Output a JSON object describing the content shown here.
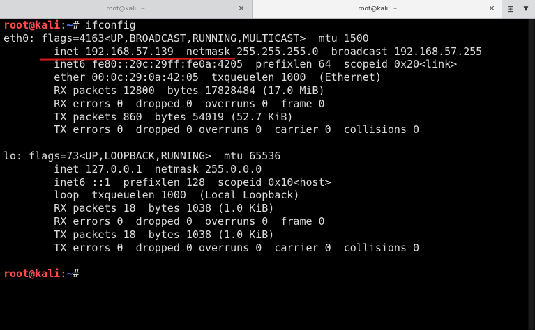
{
  "tabs": [
    {
      "title": "root@kali: ~",
      "active": false
    },
    {
      "title": "root@kali: ~",
      "active": true
    }
  ],
  "tab_close_glyph": "×",
  "new_tab_glyph": "⊞",
  "tab_menu_glyph": "▼",
  "prompt": {
    "user": "root@kali",
    "sep": ":",
    "path": "~",
    "sign": "#"
  },
  "command": " ifconfig",
  "output": [
    "eth0: flags=4163<UP,BROADCAST,RUNNING,MULTICAST>  mtu 1500",
    "        inet 192.168.57.139  netmask 255.255.255.0  broadcast 192.168.57.255",
    "        inet6 fe80::20c:29ff:fe0a:4205  prefixlen 64  scopeid 0x20<link>",
    "        ether 00:0c:29:0a:42:05  txqueuelen 1000  (Ethernet)",
    "        RX packets 12800  bytes 17828484 (17.0 MiB)",
    "        RX errors 0  dropped 0  overruns 0  frame 0",
    "        TX packets 860  bytes 54019 (52.7 KiB)",
    "        TX errors 0  dropped 0 overruns 0  carrier 0  collisions 0",
    "",
    "lo: flags=73<UP,LOOPBACK,RUNNING>  mtu 65536",
    "        inet 127.0.0.1  netmask 255.0.0.0",
    "        inet6 ::1  prefixlen 128  scopeid 0x10<host>",
    "        loop  txqueuelen 1000  (Local Loopback)",
    "        RX packets 18  bytes 1038 (1.0 KiB)",
    "        RX errors 0  dropped 0  overruns 0  frame 0",
    "        TX packets 18  bytes 1038 (1.0 KiB)",
    "        TX errors 0  dropped 0 overruns 0  carrier 0  collisions 0"
  ],
  "colors": {
    "prompt_user": "#ff4c4c",
    "prompt_path": "#4c7cff",
    "annotation": "#d51b1b",
    "terminal_bg": "#000000",
    "terminal_fg": "#dcdcdc"
  }
}
